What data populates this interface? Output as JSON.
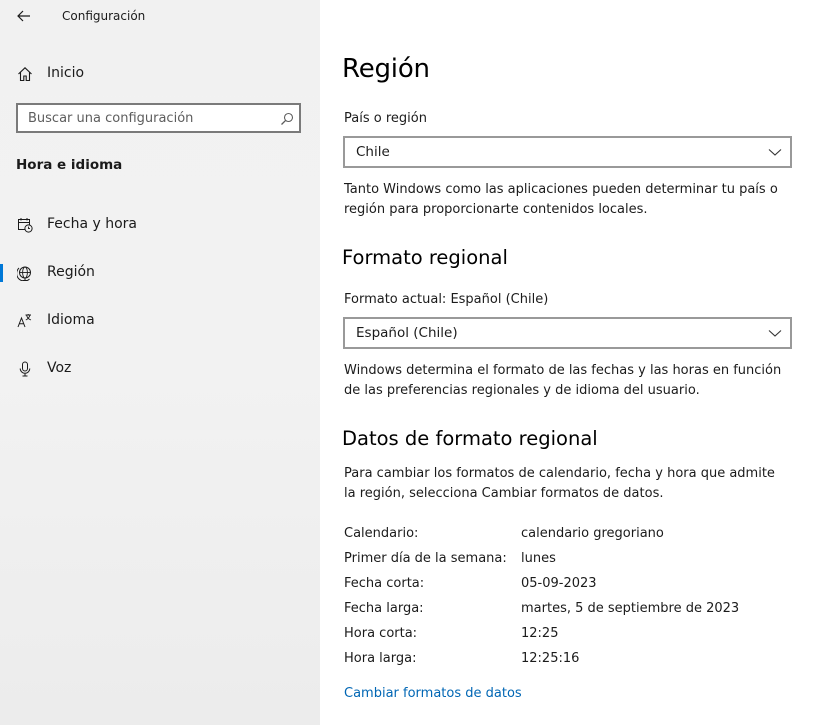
{
  "window": {
    "title": "Configuración"
  },
  "sidebar": {
    "home_label": "Inicio",
    "search": {
      "placeholder": "Buscar una configuración",
      "value": ""
    },
    "section_title": "Hora e idioma",
    "items": [
      {
        "label": "Fecha y hora",
        "icon": "calendar-clock-icon",
        "selected": false
      },
      {
        "label": "Región",
        "icon": "globe-icon",
        "selected": true
      },
      {
        "label": "Idioma",
        "icon": "language-icon",
        "selected": false
      },
      {
        "label": "Voz",
        "icon": "microphone-icon",
        "selected": false
      }
    ]
  },
  "main": {
    "title": "Región",
    "country": {
      "label": "País o región",
      "value": "Chile",
      "description": "Tanto Windows como las aplicaciones pueden determinar tu país o región para proporcionarte contenidos locales."
    },
    "regional_format": {
      "heading": "Formato regional",
      "current_label": "Formato actual: Español (Chile)",
      "value": "Español (Chile)",
      "description": "Windows determina el formato de las fechas y las horas en función de las preferencias regionales y de idioma del usuario."
    },
    "format_data": {
      "heading": "Datos de formato regional",
      "description": "Para cambiar los formatos de calendario, fecha y hora que admite la región, selecciona Cambiar formatos de datos.",
      "rows": [
        {
          "key": "Calendario:",
          "value": "calendario gregoriano"
        },
        {
          "key": "Primer día de la semana:",
          "value": "lunes"
        },
        {
          "key": "Fecha corta:",
          "value": "05-09-2023"
        },
        {
          "key": "Fecha larga:",
          "value": "martes, 5 de septiembre de 2023"
        },
        {
          "key": "Hora corta:",
          "value": "12:25"
        },
        {
          "key": "Hora larga:",
          "value": "12:25:16"
        }
      ],
      "link_label": "Cambiar formatos de datos"
    }
  },
  "colors": {
    "accent": "#0078d7",
    "link": "#0066b4",
    "sidebar_bg": "#f2f2f2"
  }
}
